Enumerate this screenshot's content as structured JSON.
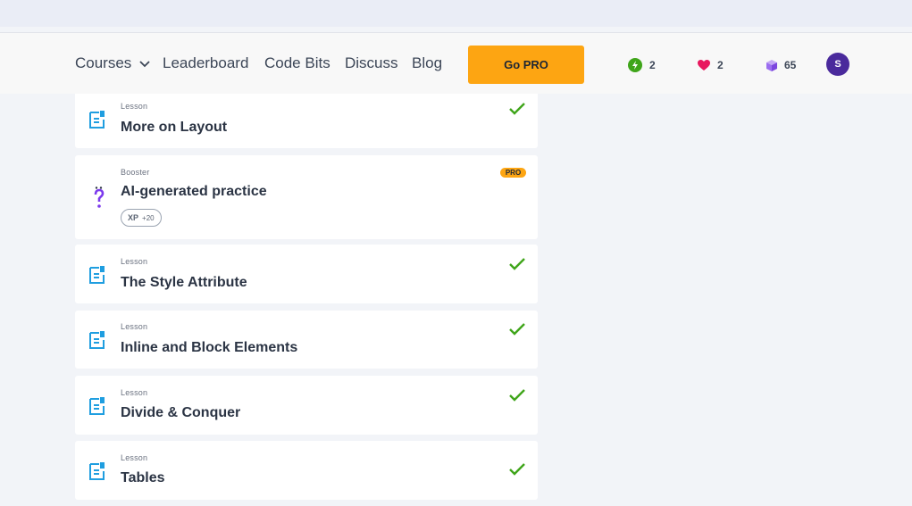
{
  "nav": {
    "courses": "Courses",
    "leaderboard": "Leaderboard",
    "code_bits": "Code Bits",
    "discuss": "Discuss",
    "blog": "Blog",
    "go_pro": "Go PRO"
  },
  "stats": {
    "streak": "2",
    "hearts": "2",
    "bits": "65"
  },
  "user": {
    "avatar_initial": "S"
  },
  "items": [
    {
      "kind": "Lesson",
      "title": "More on Layout"
    },
    {
      "kind": "Booster",
      "title": "AI-generated practice",
      "badge": "PRO",
      "xp_label": "XP",
      "xp_amount": "+20"
    },
    {
      "kind": "Lesson",
      "title": "The Style Attribute"
    },
    {
      "kind": "Lesson",
      "title": "Inline and Block Elements"
    },
    {
      "kind": "Lesson",
      "title": "Divide & Conquer"
    },
    {
      "kind": "Lesson",
      "title": "Tables"
    }
  ],
  "colors": {
    "accent": "#fda512",
    "lesson_icon": "#1f9ee0",
    "check": "#3fa51a",
    "booster_icon": "#7c3aed",
    "heart": "#e8185e",
    "streak": "#3fa51a",
    "avatar": "#4a2a9c"
  }
}
